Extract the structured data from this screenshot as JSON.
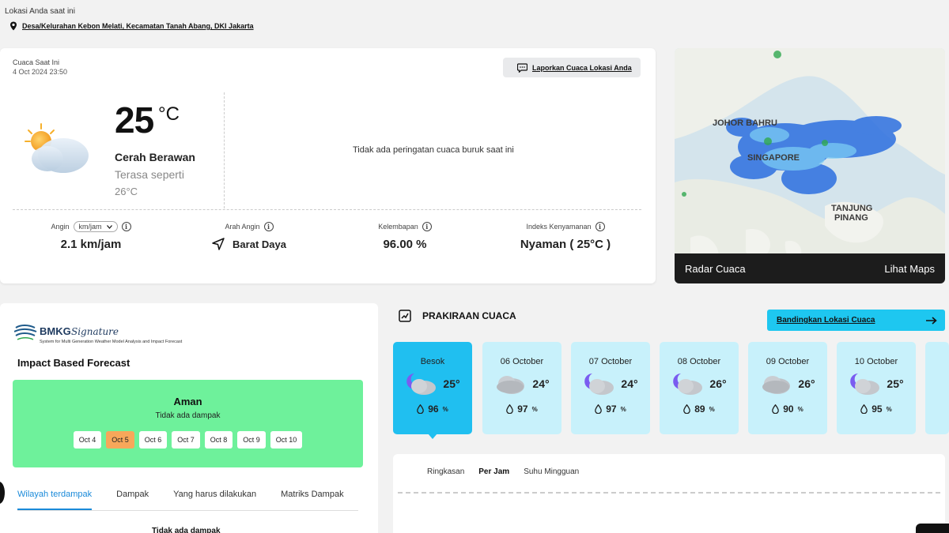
{
  "location": {
    "label": "Lokasi Anda saat ini",
    "link": "Desa/Kelurahan Kebon Melati, Kecamatan Tanah Abang, DKI Jakarta"
  },
  "current": {
    "title": "Cuaca Saat Ini",
    "timestamp": "4 Oct 2024 23:50",
    "report_label": "Laporkan Cuaca Lokasi Anda",
    "temperature": "25",
    "temp_unit": "°C",
    "condition": "Cerah Berawan",
    "feels_like_label": "Terasa seperti",
    "feels_like_value": "26°C",
    "warning": "Tidak ada peringatan cuaca buruk saat ini",
    "icon": "partly-cloudy-sun-icon",
    "stats": {
      "wind_label": "Angin",
      "wind_unit": "km/jam",
      "wind_value": "2.1 km/jam",
      "direction_label": "Arah Angin",
      "direction_value": "Barat Daya",
      "humidity_label": "Kelembapan",
      "humidity_value": "96.00 %",
      "comfort_label": "Indeks Kenyamanan",
      "comfort_value": "Nyaman ( 25°C )"
    }
  },
  "radar": {
    "map_labels": [
      "JOHOR BAHRU",
      "SINGAPORE",
      "TANJUNG",
      "PINANG"
    ],
    "title": "Radar Cuaca",
    "link": "Lihat Maps"
  },
  "impact": {
    "logo_brand": "BMKG",
    "logo_script": "Signature",
    "logo_tagline": "System for Multi Generation Weather Model Analysis and Impact Forecast",
    "title": "Impact Based Forecast",
    "status": "Aman",
    "status_sub": "Tidak ada dampak",
    "dates": [
      "Oct 4",
      "Oct 5",
      "Oct 6",
      "Oct 7",
      "Oct 8",
      "Oct 9",
      "Oct 10"
    ],
    "active_date": "Oct 5",
    "tabs": [
      "Wilayah terdampak",
      "Dampak",
      "Yang harus dilakukan",
      "Matriks Dampak"
    ],
    "active_tab": "Wilayah terdampak",
    "bottom_text": "Tidak ada dampak"
  },
  "forecast": {
    "title": "PRAKIRAAN CUACA",
    "compare_label": "Bandingkan Lokasi Cuaca",
    "days": [
      {
        "label": "Besok",
        "temp": "25°",
        "humidity": "96",
        "icon": "cloudy-night-icon",
        "active": true
      },
      {
        "label": "06 October",
        "temp": "24°",
        "humidity": "97",
        "icon": "cloud-icon",
        "active": false
      },
      {
        "label": "07 October",
        "temp": "24°",
        "humidity": "97",
        "icon": "cloudy-night-icon",
        "active": false
      },
      {
        "label": "08 October",
        "temp": "26°",
        "humidity": "89",
        "icon": "cloudy-night-icon",
        "active": false
      },
      {
        "label": "09 October",
        "temp": "26°",
        "humidity": "90",
        "icon": "cloud-icon",
        "active": false
      },
      {
        "label": "10 October",
        "temp": "25°",
        "humidity": "95",
        "icon": "cloudy-night-icon",
        "active": false
      }
    ],
    "humidity_unit": "%",
    "detail_tabs": [
      "Ringkasan",
      "Per Jam",
      "Suhu Mingguan"
    ],
    "active_detail_tab": "Per Jam"
  }
}
